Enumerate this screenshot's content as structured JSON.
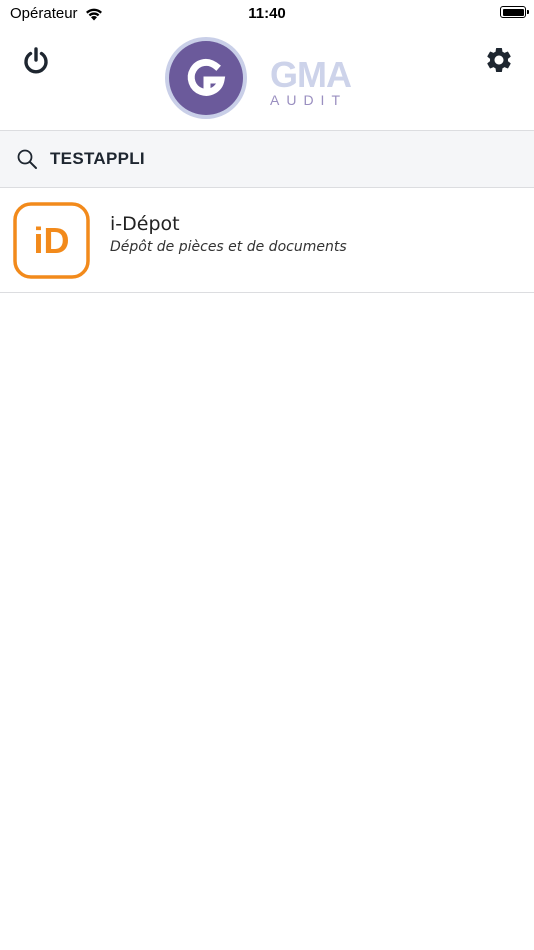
{
  "status_bar": {
    "carrier": "Opérateur",
    "time": "11:40",
    "wifi_icon": "wifi-icon",
    "battery_icon": "battery-icon"
  },
  "header": {
    "power_icon": "power-icon",
    "settings_icon": "gear-icon",
    "logo_letter": "G",
    "brand_name": "GMA",
    "brand_sub": "AUDIT"
  },
  "search": {
    "value": "TESTAPPLI",
    "icon": "search-icon"
  },
  "apps": [
    {
      "name": "i-Dépot",
      "description": "Dépôt de pièces et de documents",
      "icon_text": "iD"
    }
  ],
  "colors": {
    "logo_purple": "#6b5a9b",
    "logo_ring": "#c9cfe8",
    "brand_light": "#cdd3ea",
    "brand_sub": "#9a8fc0",
    "app_orange": "#f28a1b",
    "search_bg": "#f5f6f8",
    "icon_dark": "#1e2630"
  }
}
